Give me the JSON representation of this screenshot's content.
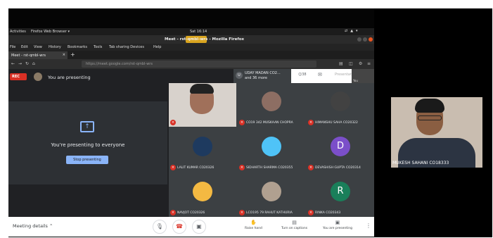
{
  "os_bar": {
    "activities": "Activities",
    "app": "Firefox Web Browser ▾",
    "clock": "Sat 16:14"
  },
  "window": {
    "title": "Meet - rst-qmbl-wrs - Mozilla Firefox"
  },
  "menu": [
    "File",
    "Edit",
    "View",
    "History",
    "Bookmarks",
    "Tools",
    "Tab sharing Devices",
    "Help"
  ],
  "tab": {
    "label": "Meet - rst-qmbl-wrs"
  },
  "url": "https://meet.google.com/rst-qmbl-wrs",
  "meet": {
    "rec": "REC",
    "presenting_label": "You are presenting",
    "participants_chip": {
      "initial": "U",
      "line1": "UDAY MADAN CO2...",
      "line2": "and 36 more"
    },
    "participant_count": "38",
    "presentation_short": "Presentation",
    "self_tile_label": "You",
    "present_message": "You're presenting to everyone",
    "stop_button": "Stop presenting"
  },
  "participants": [
    {
      "name": "",
      "initial": "",
      "color": "#9c8a78",
      "type": "video"
    },
    {
      "name": "CO19 342 MUSKAAN CHOPRA",
      "initial": "",
      "color": "#8d6e63",
      "type": "photo"
    },
    {
      "name": "HIMANSHU SAHA CO20322",
      "initial": "",
      "color": "#424242",
      "type": "photo"
    },
    {
      "name": "LALIT KUMAR CO20326",
      "initial": "",
      "color": "#1e3a5f",
      "type": "photo"
    },
    {
      "name": "SIDHARTH SHARMA CO20355",
      "initial": "",
      "color": "#4fc3f7",
      "type": "photo"
    },
    {
      "name": "DEVASHISH GUPTA CO20314",
      "initial": "D",
      "color": "#7b4fc9",
      "type": "letter"
    },
    {
      "name": "NAVJOT CO20326",
      "initial": "",
      "color": "#f4b942",
      "type": "photo"
    },
    {
      "name": "LCO195 79 RAHUT KATHURIA",
      "initial": "",
      "color": "#b0a090",
      "type": "photo"
    },
    {
      "name": "RINKA CO20343",
      "initial": "R",
      "color": "#1a7f5a",
      "type": "letter"
    }
  ],
  "bottom_bar": {
    "meeting_details": "Meeting details",
    "raise_hand": "Raise hand",
    "captions": "Turn on captions",
    "presenting": "You are presenting"
  },
  "camera": {
    "name": "MUKESH SAHANI CO18333"
  },
  "colors": {
    "rec_red": "#d93025",
    "meet_bg": "#202124",
    "accent_blue": "#8ab4f8"
  }
}
